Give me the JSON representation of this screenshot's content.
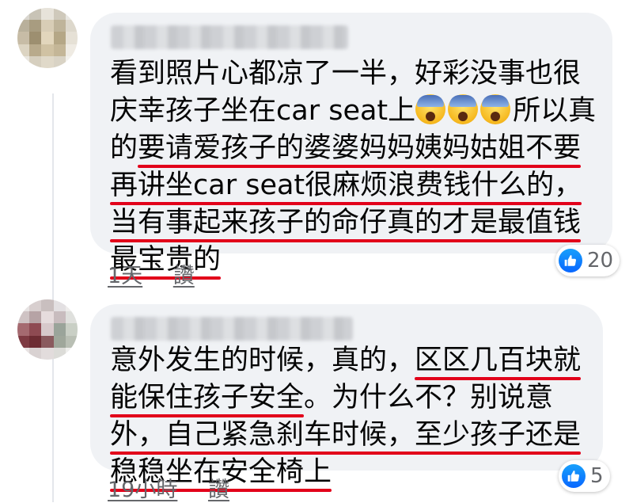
{
  "comments": [
    {
      "lines": [
        [
          {
            "t": "看到照片心都凉了一半，好彩没事也很",
            "u": false
          }
        ],
        [
          {
            "t": "庆幸孩子坐在car seat上",
            "u": false
          },
          {
            "emoji": "face-screaming-in-fear-icon"
          },
          {
            "emoji": "face-screaming-in-fear-icon"
          },
          {
            "emoji": "face-screaming-in-fear-icon"
          },
          {
            "t": "所以真",
            "u": false
          }
        ],
        [
          {
            "t": "的",
            "u": false
          },
          {
            "t": "要请爱孩子的婆婆妈妈姨妈姑姐不要",
            "u": true
          }
        ],
        [
          {
            "t": "再讲坐car seat很麻烦浪费钱什么的，",
            "u": true
          }
        ],
        [
          {
            "t": "当有事起来孩子的命仔真的才是最值钱",
            "u": true
          }
        ],
        [
          {
            "t": "最宝贵的",
            "u": true
          }
        ]
      ],
      "time": "1天",
      "like_action": "讚",
      "reaction_count": "20"
    },
    {
      "lines": [
        [
          {
            "t": "意外发生的时候，真的，",
            "u": false
          },
          {
            "t": "区区几百块就",
            "u": true
          }
        ],
        [
          {
            "t": "能保住孩子安全",
            "u": true
          },
          {
            "t": "。为什么不？别说意",
            "u": false
          }
        ],
        [
          {
            "t": "外，自己紧急刹车时候，至少孩子还是",
            "u": true
          }
        ],
        [
          {
            "t": "稳稳坐在安全椅上",
            "u": true
          }
        ]
      ],
      "time": "19小時",
      "like_action": "讚",
      "reaction_count": "5"
    }
  ],
  "colors": {
    "bubble": "#f0f2f5",
    "underline": "#e2001a",
    "meta_text": "#65676b",
    "like_blue": "#0866ff"
  },
  "avatars": [
    {
      "pixels": [
        "#d9d6cf",
        "#c8c3b6",
        "#e7e3da",
        "#cfc9bb",
        "#e9e7e2",
        "#b9b09b",
        "#a89c80",
        "#d8cdb6",
        "#bfb49a",
        "#ddd8cc",
        "#c7bca6",
        "#9d8f70",
        "#e2d6bc",
        "#b5a786",
        "#e6e1d6",
        "#dcd4c2",
        "#b8aa8c",
        "#d0c2a3",
        "#c4b697",
        "#efebe3",
        "#e9e6df",
        "#d6cfbf",
        "#e0d9c9",
        "#d9d3c5",
        "#f3f1ec"
      ]
    },
    {
      "pixels": [
        "#e7e3e3",
        "#d8cfcf",
        "#c9bfbf",
        "#e3e0e2",
        "#eeeceb",
        "#cfc3c4",
        "#b6a3a5",
        "#e6dcdd",
        "#c8bcbe",
        "#dfe0dd",
        "#a56a70",
        "#8e4a52",
        "#d7c9cb",
        "#9aa49a",
        "#c9cfc5",
        "#7e3a42",
        "#6d2c33",
        "#8a5a5e",
        "#9fa79b",
        "#b9bfb4",
        "#e8e3e3",
        "#d9d2d2",
        "#e2dcdc",
        "#dcdcd8",
        "#eeeeec"
      ]
    }
  ]
}
